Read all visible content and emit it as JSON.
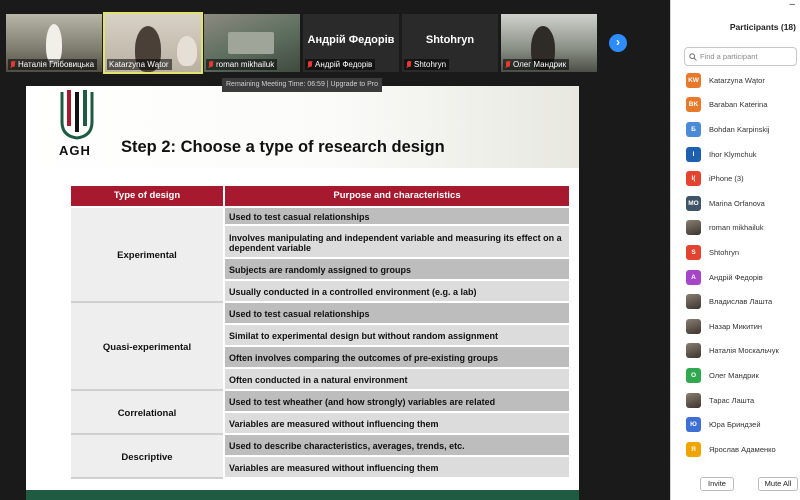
{
  "video_strip": {
    "tiles": [
      {
        "label": "Наталія Глібовицька",
        "muted": true
      },
      {
        "label": "Katarzyna Wątor",
        "muted": false,
        "active": true
      },
      {
        "label": "roman mikhailuk",
        "muted": true
      },
      {
        "label": "Андрій Федорів",
        "name_large": "Андрій Федорів",
        "muted": true
      },
      {
        "label": "Shtohryn",
        "name_large": "Shtohryn",
        "muted": true
      },
      {
        "label": "Олег Мандрик",
        "muted": true
      }
    ],
    "next_icon": "chevron-right-icon"
  },
  "meeting": {
    "timer_text": "Remaining Meeting Time: 06:59 | Upgrade to Pro"
  },
  "slide": {
    "logo_text": "AGH",
    "title": "Step 2: Choose a type of research design",
    "colors": {
      "header": "#a6192e",
      "footer": "#1f5b43",
      "row_dark": "#bdbdbd",
      "row_light": "#dcdcdc"
    },
    "table": {
      "headers": [
        "Type of design",
        "Purpose and characteristics"
      ],
      "groups": [
        {
          "type": "Experimental",
          "rows": [
            "Used to test casual relationships",
            "Involves manipulating and independent variable and measuring its effect on a dependent variable",
            "Subjects are randomly assigned to groups",
            "Usually conducted in a controlled environment (e.g. a lab)"
          ]
        },
        {
          "type": "Quasi-experimental",
          "rows": [
            "Used to test casual relationships",
            "Similat to experimental design but without random assignment",
            "Often involves comparing the outcomes of pre-existing groups",
            "Often conducted in a natural environment"
          ]
        },
        {
          "type": "Correlational",
          "rows": [
            "Used to test wheather (and how strongly) variables are related",
            "Variables are measured without influencing them"
          ]
        },
        {
          "type": "Descriptive",
          "rows": [
            "Used to describe characteristics, averages, trends, etc.",
            "Variables are measured without influencing them"
          ]
        }
      ]
    }
  },
  "participants_panel": {
    "minimize_glyph": "–",
    "title": "Participants (18)",
    "search_placeholder": "Find a participant",
    "participants": [
      {
        "initials": "KW",
        "name": "Katarzyna Wątor",
        "color": "#e8792a"
      },
      {
        "initials": "BK",
        "name": "Baraban Katerina",
        "color": "#e8792a"
      },
      {
        "initials": "Б",
        "name": "Bohdan Karpinskij",
        "color": "#4a8ad6"
      },
      {
        "initials": "I",
        "name": "Ihor Klymchuk",
        "color": "#1f5fb0"
      },
      {
        "initials": "I(",
        "name": "iPhone (3)",
        "color": "#e4432f"
      },
      {
        "initials": "MO",
        "name": "Marina Orfanova",
        "color": "#3f5467"
      },
      {
        "initials": "",
        "name": "roman mikhailuk",
        "photo": true
      },
      {
        "initials": "S",
        "name": "Shtohryn",
        "color": "#e4432f"
      },
      {
        "initials": "А",
        "name": "Андрій Федорів",
        "color": "#a546c9"
      },
      {
        "initials": "",
        "name": "Владислав Лашта",
        "photo": true
      },
      {
        "initials": "",
        "name": "Назар Микитин",
        "photo": true
      },
      {
        "initials": "",
        "name": "Наталія Москальчук",
        "photo": true
      },
      {
        "initials": "О",
        "name": "Олег Мандрик",
        "color": "#2fa84f"
      },
      {
        "initials": "",
        "name": "Тарас Лашта",
        "photo": true
      },
      {
        "initials": "Ю",
        "name": "Юра Бриндзей",
        "color": "#3d6fd6"
      },
      {
        "initials": "Я",
        "name": "Ярослав Адаменко",
        "color": "#f0a400"
      }
    ],
    "invite_label": "Invite",
    "mute_all_label": "Mute All"
  }
}
